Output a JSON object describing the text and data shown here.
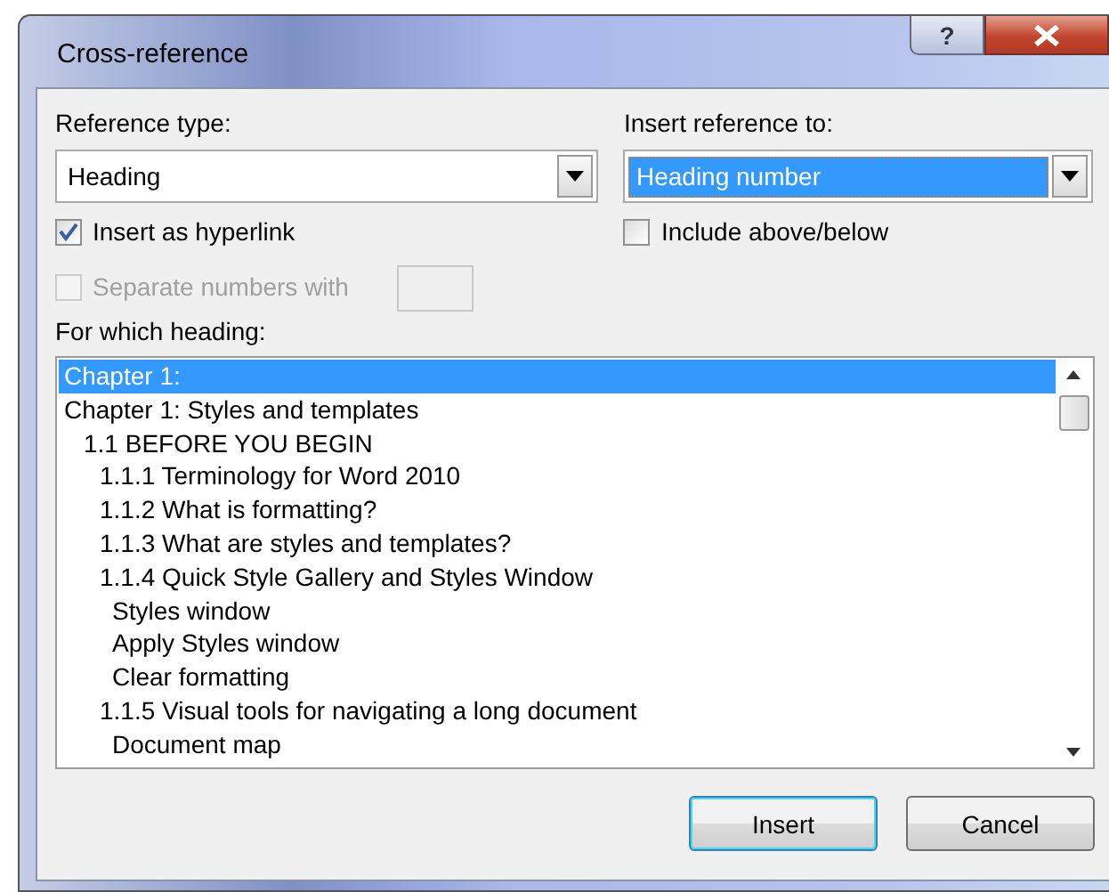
{
  "window": {
    "title": "Cross-reference",
    "help_button": "?"
  },
  "reference_type": {
    "label": "Reference type:",
    "value": "Heading"
  },
  "insert_reference_to": {
    "label": "Insert reference to:",
    "value": "Heading number",
    "selected": true
  },
  "checkboxes": [
    {
      "label": "Insert as hyperlink",
      "checked": true,
      "disabled": false
    },
    {
      "label": "Include above/below",
      "checked": false,
      "disabled": false
    }
  ],
  "separate_numbers": {
    "label": "Separate numbers with",
    "checked": false,
    "disabled": true
  },
  "headings": {
    "label": "For which heading:",
    "items": [
      {
        "text": "Chapter 1:",
        "selected": true
      },
      {
        "text": "Chapter 1: Styles and templates",
        "selected": false,
        "children": [
          {
            "text": "1.1 BEFORE YOU BEGIN",
            "selected": false,
            "children": [
              {
                "text": "1.1.1 Terminology for Word 2010",
                "selected": false
              },
              {
                "text": "1.1.2 What is formatting?",
                "selected": false
              },
              {
                "text": "1.1.3 What are styles and templates?",
                "selected": false
              },
              {
                "text": "1.1.4 Quick Style Gallery and Styles Window",
                "selected": false,
                "children": [
                  {
                    "text": "Styles window",
                    "selected": false
                  },
                  {
                    "text": "Apply Styles window",
                    "selected": false
                  },
                  {
                    "text": "Clear formatting",
                    "selected": false
                  }
                ]
              },
              {
                "text": "1.1.5 Visual tools for navigating a long document",
                "selected": false,
                "children": [
                  {
                    "text": "Document map",
                    "selected": false
                  }
                ]
              }
            ]
          }
        ]
      }
    ]
  },
  "buttons": [
    {
      "label": "Insert",
      "default": true
    },
    {
      "label": "Cancel",
      "default": false
    }
  ]
}
